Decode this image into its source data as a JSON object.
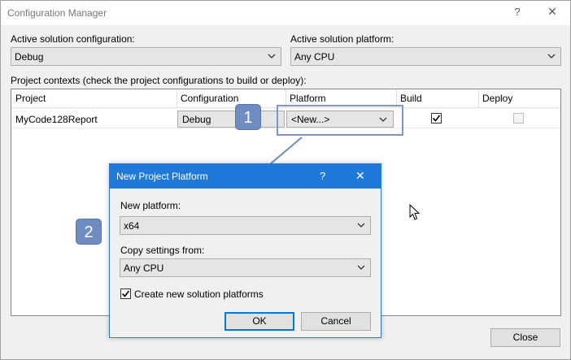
{
  "window": {
    "title": "Configuration Manager",
    "help_glyph": "?",
    "close_glyph": "✕"
  },
  "solution": {
    "config_label": "Active solution configuration:",
    "config_value": "Debug",
    "platform_label": "Active solution platform:",
    "platform_value": "Any CPU"
  },
  "contexts": {
    "label": "Project contexts (check the project configurations to build or deploy):",
    "columns": [
      "Project",
      "Configuration",
      "Platform",
      "Build",
      "Deploy"
    ],
    "rows": [
      {
        "project": "MyCode128Report",
        "configuration": "Debug",
        "platform": "<New...>",
        "build": true,
        "deploy": false
      }
    ]
  },
  "annotations": {
    "step1": "1",
    "step2": "2",
    "accent": "#6f8cc0"
  },
  "dialog": {
    "title": "New Project Platform",
    "help_glyph": "?",
    "close_glyph": "✕",
    "new_platform_label": "New platform:",
    "new_platform_value": "x64",
    "copy_label": "Copy settings from:",
    "copy_value": "Any CPU",
    "create_checkbox_label": "Create new solution platforms",
    "create_checked": true,
    "ok_label": "OK",
    "cancel_label": "Cancel",
    "titlebar_color": "#1e79d8"
  },
  "footer": {
    "close_label": "Close"
  }
}
